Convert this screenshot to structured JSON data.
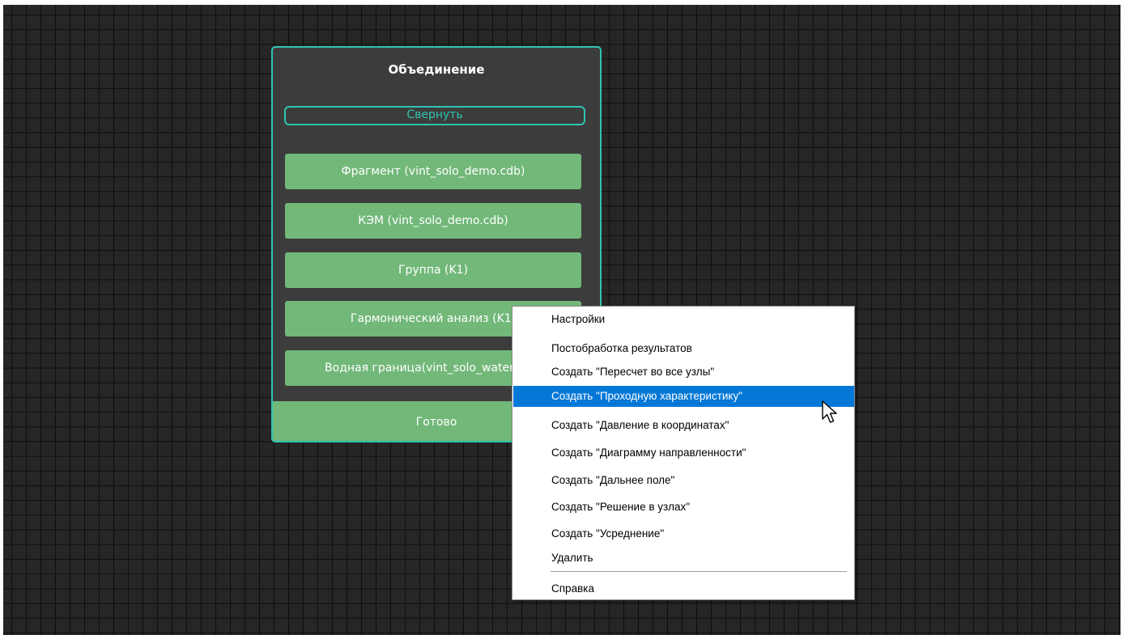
{
  "node": {
    "title": "Объединение",
    "collapse_label": "Свернуть",
    "items": [
      "Фрагмент (vint_solo_demo.cdb)",
      "КЭМ (vint_solo_demo.cdb)",
      "Группа (K1)",
      "Гармонический анализ (K1)",
      "Водная граница(vint_solo_water.cdb)"
    ],
    "done_label": "Готово",
    "accent_color": "#2fc4b0",
    "item_color": "#72b879"
  },
  "context_menu": {
    "items": [
      "Настройки",
      "Постобработка результатов",
      "Создать \"Пересчет во все узлы\"",
      "Создать \"Проходную характеристику\"",
      "Создать \"Давление в координатах\"",
      "Создать \"Диаграмму направленности\"",
      "Создать \"Дальнее поле\"",
      "Создать \"Решение в узлах\"",
      "Создать \"Усреднение\"",
      "Удалить"
    ],
    "selected_index": 3,
    "footer_item": "Справка",
    "highlight_color": "#0478d7"
  },
  "icons": {
    "pointer": "arrow-cursor-icon"
  }
}
